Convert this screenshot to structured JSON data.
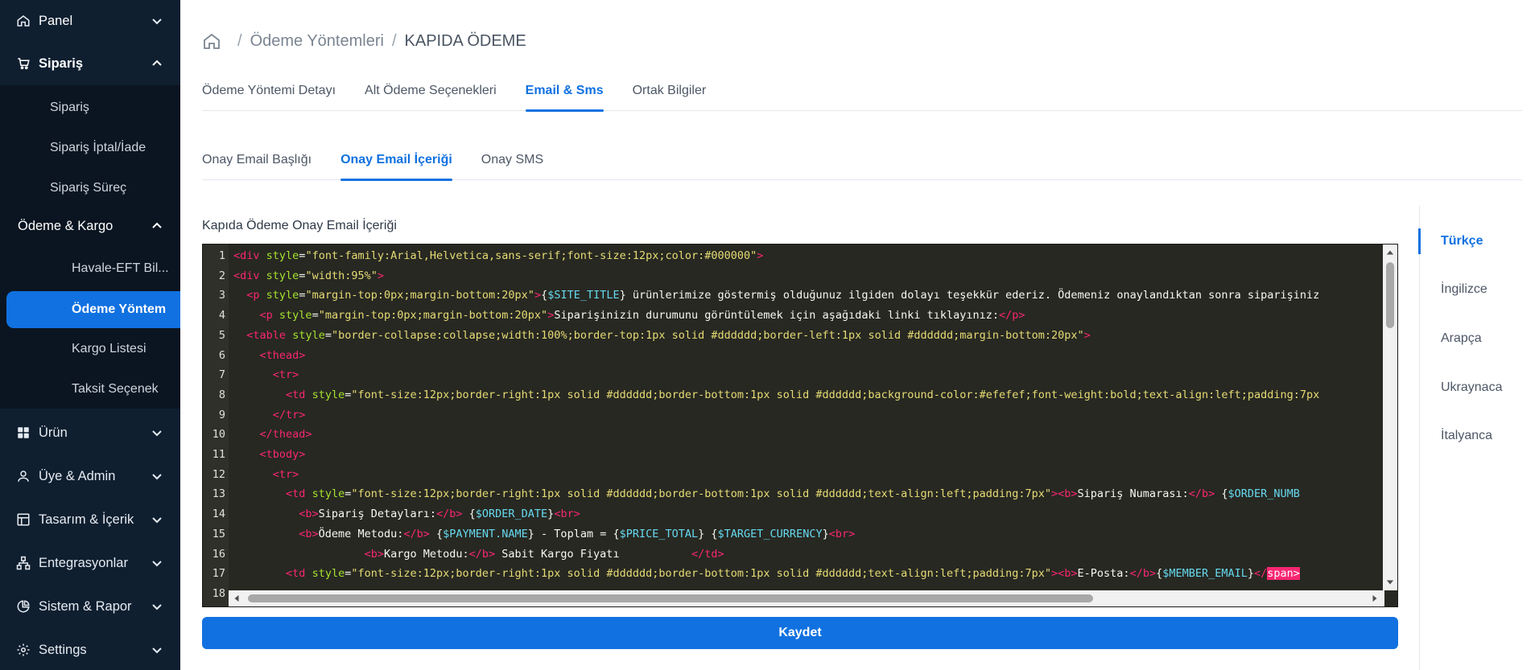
{
  "sidebar": {
    "panel": "Panel",
    "siparis": "Sipariş",
    "siparis_sub": [
      "Sipariş",
      "Sipariş İptal/İade",
      "Sipariş Süreç"
    ],
    "odeme_kargo": "Ödeme & Kargo",
    "odeme_kargo_sub": [
      "Havale-EFT Bil...",
      "Ödeme Yöntem",
      "Kargo Listesi",
      "Taksit Seçenek"
    ],
    "urun": "Ürün",
    "uye_admin": "Üye & Admin",
    "tasarim": "Tasarım & İçerik",
    "entegrasyonlar": "Entegrasyonlar",
    "sistem_rapor": "Sistem & Rapor",
    "settings": "Settings"
  },
  "breadcrumb": {
    "sep": "/",
    "items": [
      "Ödeme Yöntemleri",
      "KAPIDA ÖDEME"
    ]
  },
  "main_tabs": [
    "Ödeme Yöntemi Detayı",
    "Alt Ödeme Seçenekleri",
    "Email & Sms",
    "Ortak Bilgiler"
  ],
  "sub_tabs": [
    "Onay Email Başlığı",
    "Onay Email İçeriği",
    "Onay SMS"
  ],
  "editor": {
    "label": "Kapıda Ödeme Onay Email İçeriği",
    "line_numbers": [
      "1",
      "2",
      "3",
      "4",
      "5",
      "6",
      "7",
      "8",
      "9",
      "10",
      "11",
      "12",
      "13",
      "14",
      "15",
      "16",
      "17",
      "18"
    ]
  },
  "save_label": "Kaydet",
  "languages": [
    "Türkçe",
    "İngilizce",
    "Arapça",
    "Ukraynaca",
    "İtalyanca"
  ],
  "colors": {
    "accent": "#1171e0",
    "sidebar_bg": "#0f1f30",
    "editor_bg": "#272822"
  }
}
